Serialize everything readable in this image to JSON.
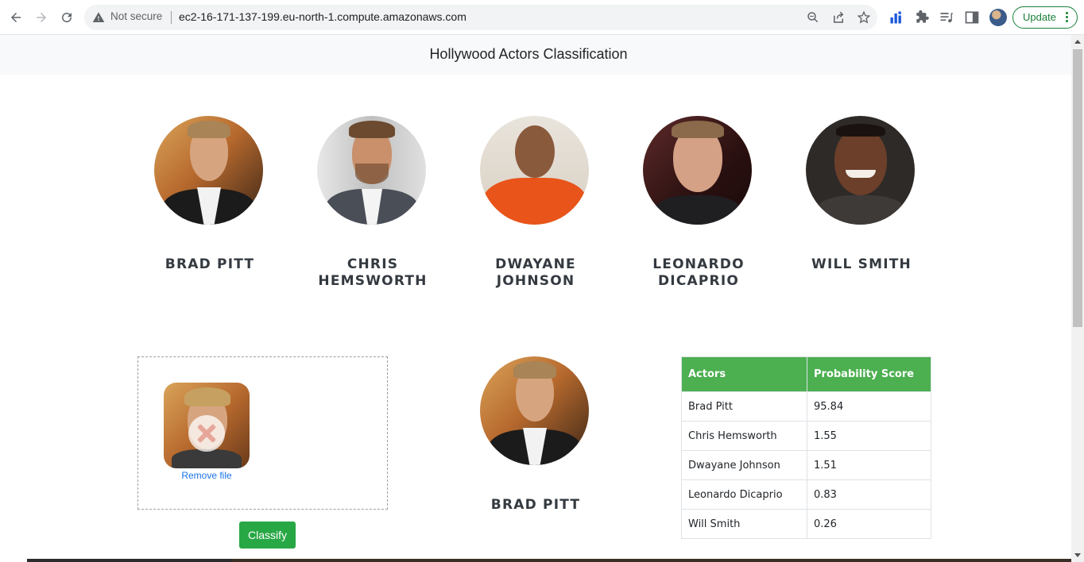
{
  "browser": {
    "security_label": "Not secure",
    "url": "ec2-16-171-137-199.eu-north-1.compute.amazonaws.com",
    "update_label": "Update",
    "icons": [
      "back-icon",
      "forward-icon",
      "reload-icon",
      "warning-icon",
      "zoom-icon",
      "share-icon",
      "star-icon",
      "extension-chart-icon",
      "puzzle-icon",
      "media-icon",
      "sidepanel-icon",
      "profile-avatar",
      "menu-dots-icon"
    ]
  },
  "page": {
    "title": "Hollywood Actors Classification"
  },
  "actors": [
    {
      "name": "BRAD PITT"
    },
    {
      "name": "CHRIS HEMSWORTH"
    },
    {
      "name": "DWAYANE JOHNSON"
    },
    {
      "name": "LEONARDO DICAPRIO"
    },
    {
      "name": "WILL SMITH"
    }
  ],
  "upload": {
    "remove_label": "Remove file",
    "classify_label": "Classify"
  },
  "result": {
    "name": "BRAD PITT"
  },
  "table": {
    "headers": [
      "Actors",
      "Probability Score"
    ],
    "rows": [
      [
        "Brad Pitt",
        "95.84"
      ],
      [
        "Chris Hemsworth",
        "1.55"
      ],
      [
        "Dwayane Johnson",
        "1.51"
      ],
      [
        "Leonardo Dicaprio",
        "0.83"
      ],
      [
        "Will Smith",
        "0.26"
      ]
    ]
  },
  "colors": {
    "table_header": "#4caf50",
    "classify_button": "#28a745",
    "link": "#1a73e8",
    "update": "#188038"
  }
}
